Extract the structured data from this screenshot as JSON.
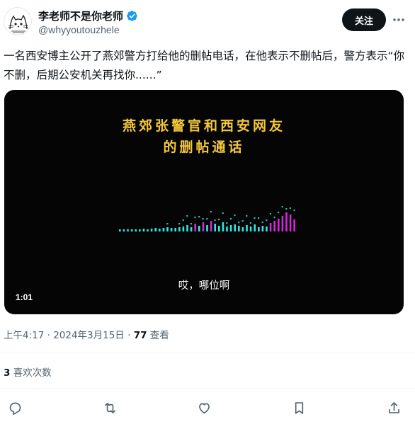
{
  "author": {
    "display_name": "李老师不是你老师",
    "handle": "@whyyoutouzhele",
    "verified": true
  },
  "actions_top": {
    "follow_label": "关注",
    "more_icon": "more-horizontal-icon"
  },
  "tweet": {
    "text": "一名西安博主公开了燕郊警方打给他的删帖电话，在他表示不删帖后，警方表示“你不删，后期公安机关再找你......”"
  },
  "video": {
    "title_line1": "燕郊张警官和西安网友",
    "title_line2": "的删帖通话",
    "subtitle": "哎，哪位啊",
    "duration": "1:01",
    "title_color": "#f3c83a",
    "wave_colors": [
      "#2ee6e0",
      "#d22ad6"
    ]
  },
  "meta": {
    "time_date": "上午4:17 · 2024年3月15日 · ",
    "views_count": "77",
    "views_label": " 查看"
  },
  "engagement": {
    "likes_count": "3",
    "likes_label": " 喜欢次数"
  },
  "bottom_actions": [
    "reply-icon",
    "retweet-icon",
    "like-icon",
    "bookmark-icon",
    "share-icon"
  ]
}
